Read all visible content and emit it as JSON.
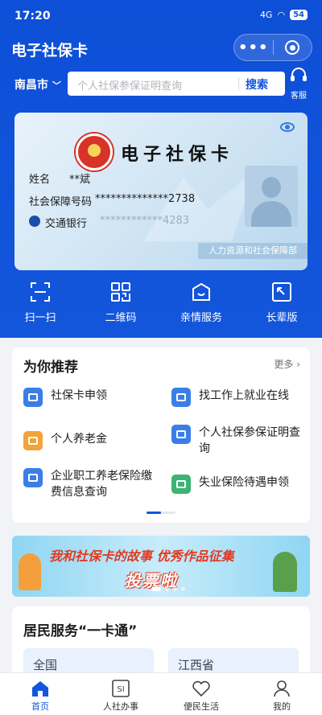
{
  "status_bar": {
    "time": "17:20",
    "signal": "4G",
    "battery": "54"
  },
  "header": {
    "title": "电子社保卡",
    "more_icon": "more-dots-icon",
    "close_icon": "target-circle-icon"
  },
  "search": {
    "city": "南昌市",
    "placeholder": "个人社保参保证明查询",
    "button": "搜索",
    "service_label": "客服"
  },
  "card": {
    "title": "电子社保卡",
    "name_label": "姓名",
    "name_value": "**斌",
    "id_label": "社会保障号码",
    "id_value": "**************2738",
    "bank_name": "交通银行",
    "bank_value": "************4283",
    "issuer": "人力资源和社会保障部"
  },
  "quick_actions": [
    {
      "label": "扫一扫",
      "icon": "scan-icon"
    },
    {
      "label": "二维码",
      "icon": "qrcode-icon"
    },
    {
      "label": "亲情服务",
      "icon": "family-service-icon"
    },
    {
      "label": "长辈版",
      "icon": "elder-mode-icon"
    }
  ],
  "recommend": {
    "title": "为你推荐",
    "more": "更多",
    "items": [
      {
        "label": "社保卡申领",
        "color": "#3a7ee8"
      },
      {
        "label": "找工作上就业在线",
        "color": "#3a7ee8"
      },
      {
        "label": "个人养老金",
        "color": "#f2a33a"
      },
      {
        "label": "个人社保参保证明查询",
        "color": "#3a7ee8"
      },
      {
        "label": "企业职工养老保险缴费信息查询",
        "color": "#3a7ee8"
      },
      {
        "label": "失业保险待遇申领",
        "color": "#3cb371"
      }
    ]
  },
  "banner": {
    "line1": "我和社保卡的故事 优秀作品征集",
    "line2": "投票啦"
  },
  "resident": {
    "title": "居民服务“一卡通”",
    "cards": [
      "全国",
      "江西省"
    ]
  },
  "tabbar": [
    {
      "label": "首页",
      "icon": "home-icon",
      "active": true
    },
    {
      "label": "人社办事",
      "icon": "si-icon",
      "active": false
    },
    {
      "label": "便民生活",
      "icon": "heart-hands-icon",
      "active": false
    },
    {
      "label": "我的",
      "icon": "user-icon",
      "active": false
    }
  ],
  "colors": {
    "brand": "#1356dc",
    "background": "#f1f3f6"
  }
}
